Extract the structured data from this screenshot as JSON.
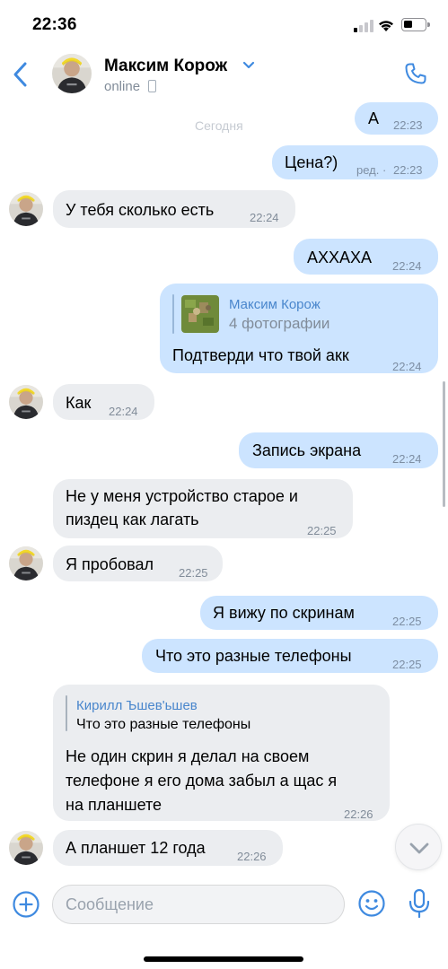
{
  "status_bar": {
    "time": "22:36"
  },
  "header": {
    "contact_name": "Максим Корож",
    "status": "online",
    "accent": "#3f8ae0"
  },
  "chat": {
    "date_separator": "Сегодня",
    "messages": [
      {
        "side": "out",
        "text": "А",
        "time": "22:23"
      },
      {
        "side": "out",
        "text": "Цена?)",
        "edited": "ред. ·",
        "time": "22:23"
      },
      {
        "side": "in",
        "text": "У тебя сколько есть",
        "time": "22:24"
      },
      {
        "side": "out",
        "text": "АХХАХА",
        "time": "22:24"
      },
      {
        "side": "out",
        "forwarded_from": "Максим Корож",
        "forwarded_sub": "4 фотографии",
        "text": "Подтверди что твой акк",
        "time": "22:24"
      },
      {
        "side": "in",
        "text": "Как",
        "time": "22:24"
      },
      {
        "side": "out",
        "text": "Запись экрана",
        "time": "22:24"
      },
      {
        "side": "in",
        "lines": [
          "Не у меня устройство старое и",
          "пиздец как лагать"
        ],
        "time": "22:25"
      },
      {
        "side": "in",
        "text": "Я пробовал",
        "time": "22:25"
      },
      {
        "side": "out",
        "text": "Я вижу по скринам",
        "time": "22:25"
      },
      {
        "side": "out",
        "text": "Что это разные телефоны",
        "time": "22:25"
      },
      {
        "side": "in",
        "reply_name": "Кирилл Ъшев'ьшев",
        "reply_text": "Что это разные телефоны",
        "lines": [
          "Не один скрин я делал на своем",
          "телефоне я его дома забыл а щас я",
          "на планшете"
        ],
        "time": "22:26"
      },
      {
        "side": "in",
        "text": "А планшет 12 года",
        "time": "22:26"
      }
    ]
  },
  "composer": {
    "placeholder": "Сообщение"
  },
  "icons": {
    "back": "chevron-left-icon",
    "phone": "phone-icon",
    "plus": "plus-circle-icon",
    "smile": "smile-icon",
    "mic": "microphone-icon",
    "scroll_down": "chevron-down-icon"
  },
  "colors": {
    "outgoing_bubble": "#cce4ff",
    "incoming_bubble": "#ebedf0",
    "link": "#4986cc"
  }
}
